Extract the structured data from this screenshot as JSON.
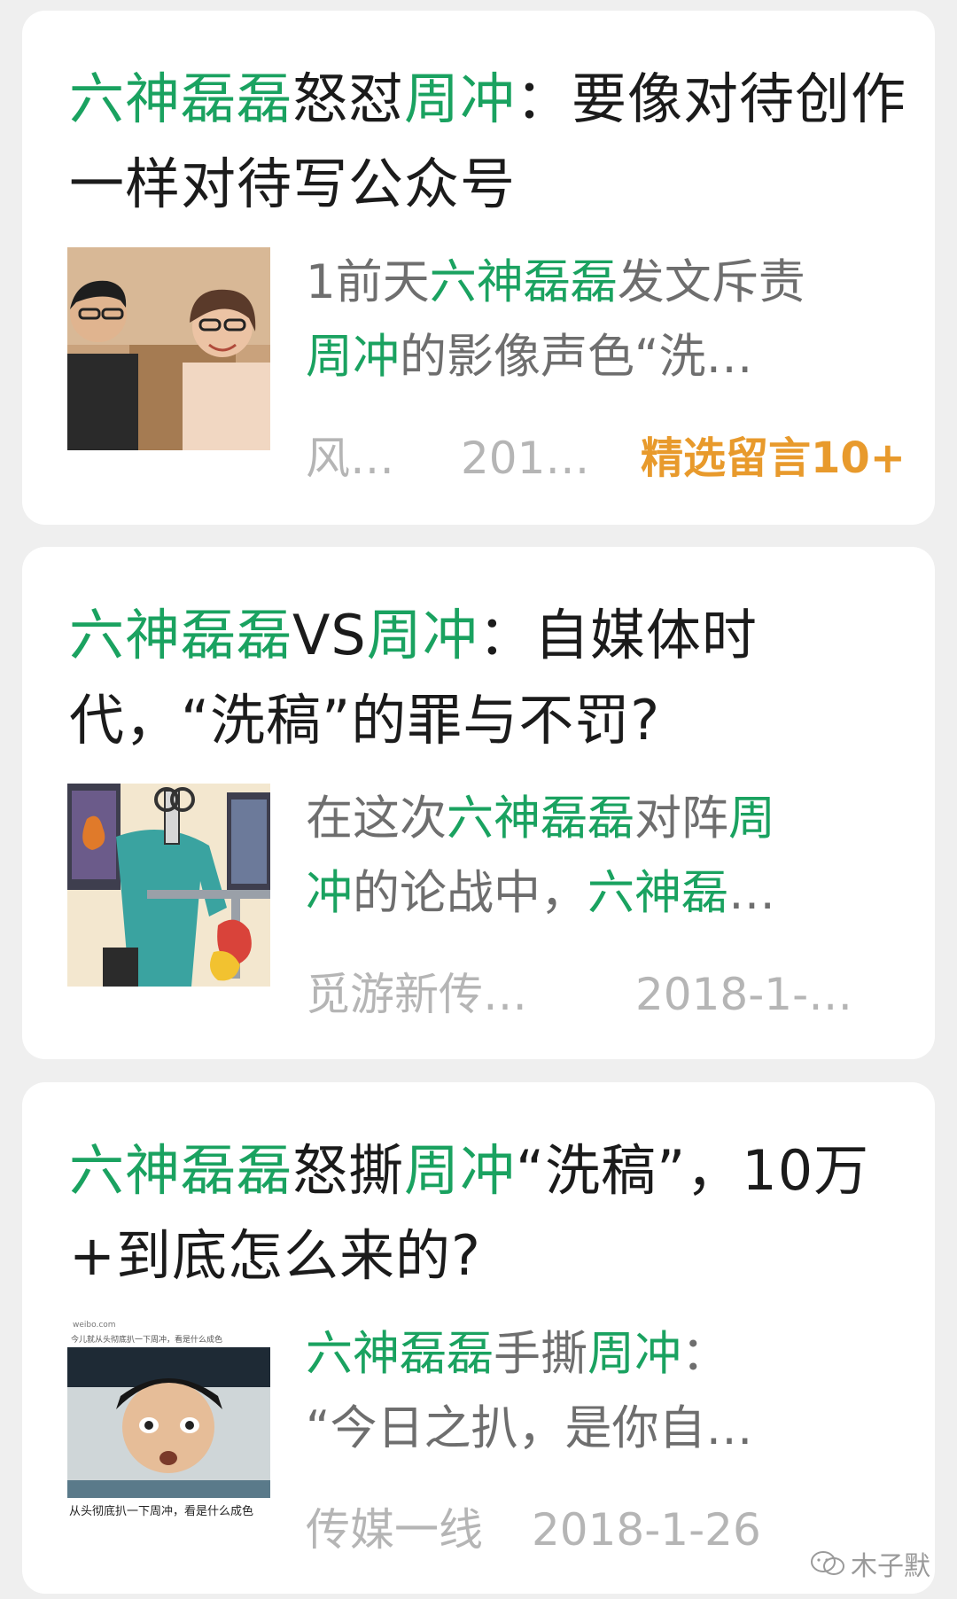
{
  "results": [
    {
      "title_parts": [
        {
          "text": "六神磊磊",
          "hl": true
        },
        {
          "text": "怒怼",
          "hl": false
        },
        {
          "text": "周冲",
          "hl": true
        },
        {
          "text": "：要像对待创作一样对待写公众号",
          "hl": false
        }
      ],
      "snippet_lines": [
        [
          {
            "text": "1前天",
            "hl": false
          },
          {
            "text": "六神磊磊",
            "hl": true
          },
          {
            "text": "发文斥责",
            "hl": false
          }
        ],
        [
          {
            "text": "周冲",
            "hl": true
          },
          {
            "text": "的影像声色“洗…",
            "hl": false
          }
        ]
      ],
      "source": "风…",
      "date": "201…",
      "badge": "精选留言10+",
      "thumb_icon": "photo-two-people-icon"
    },
    {
      "title_parts": [
        {
          "text": "六神磊磊",
          "hl": true
        },
        {
          "text": "VS",
          "hl": false
        },
        {
          "text": "周冲",
          "hl": true
        },
        {
          "text": "：自媒体时代，“洗稿”的罪与不罚?",
          "hl": false
        }
      ],
      "snippet_lines": [
        [
          {
            "text": "在这次",
            "hl": false
          },
          {
            "text": "六神磊磊",
            "hl": true
          },
          {
            "text": "对阵",
            "hl": false
          },
          {
            "text": "周",
            "hl": true
          }
        ],
        [
          {
            "text": "冲",
            "hl": true
          },
          {
            "text": "的论战中，",
            "hl": false
          },
          {
            "text": "六神磊",
            "hl": true
          },
          {
            "text": "…",
            "hl": false
          }
        ]
      ],
      "source": "觅游新传…",
      "date": "2018-1-…",
      "badge": "",
      "thumb_icon": "cartoon-scissors-illustration-icon"
    },
    {
      "title_parts": [
        {
          "text": "六神磊磊",
          "hl": true
        },
        {
          "text": "怒撕",
          "hl": false
        },
        {
          "text": "周冲",
          "hl": true
        },
        {
          "text": "“洗稿”，10万+到底怎么来的?",
          "hl": false
        }
      ],
      "snippet_lines": [
        [
          {
            "text": "六神磊磊",
            "hl": true
          },
          {
            "text": "手撕",
            "hl": false
          },
          {
            "text": "周冲",
            "hl": true
          },
          {
            "text": "：",
            "hl": false
          }
        ],
        [
          {
            "text": "“今日之扒，是你自…",
            "hl": false
          }
        ]
      ],
      "source": "传媒一线",
      "date": "2018-1-26",
      "badge": "",
      "thumb_icon": "weibo-screenshot-meme-icon",
      "thumb_text": {
        "top_url": "weibo.com",
        "top_caption": "今儿就从头彻底扒一下周冲，看是什么成色",
        "bottom_caption": "从头彻底扒一下周冲，看是什么成色"
      }
    }
  ],
  "watermark": "木子默",
  "colors": {
    "highlight": "#1aa260",
    "badge": "#e89a2c",
    "meta": "#b5b5b5",
    "snippet": "#6e6e6e"
  }
}
